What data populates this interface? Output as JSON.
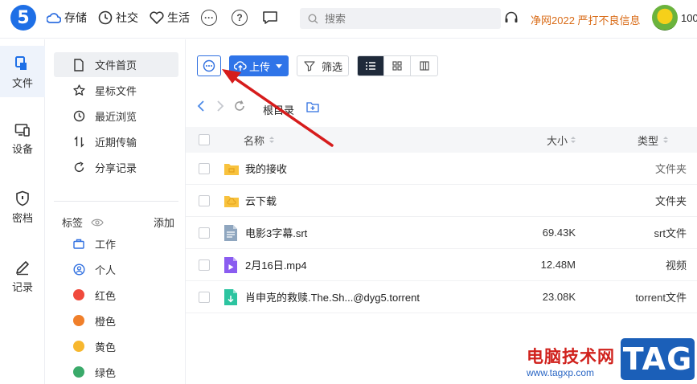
{
  "logo": "5",
  "nav": {
    "storage": "存储",
    "social": "社交",
    "life": "生活",
    "more": "···",
    "help": "?"
  },
  "search": {
    "placeholder": "搜索"
  },
  "promo": "净网2022 严打不良信息",
  "user": {
    "name": "100"
  },
  "rail": [
    {
      "label": "文件"
    },
    {
      "label": "设备"
    },
    {
      "label": "密档"
    },
    {
      "label": "记录"
    }
  ],
  "sidebar": {
    "items": [
      {
        "label": "文件首页"
      },
      {
        "label": "星标文件"
      },
      {
        "label": "最近浏览"
      },
      {
        "label": "近期传输"
      },
      {
        "label": "分享记录"
      }
    ],
    "tags_title": "标签",
    "tags_add": "添加",
    "tags": [
      {
        "label": "工作"
      },
      {
        "label": "个人"
      },
      {
        "label": "红色",
        "color": "#f04a3c"
      },
      {
        "label": "橙色",
        "color": "#f07f2a"
      },
      {
        "label": "黄色",
        "color": "#f7b72e"
      },
      {
        "label": "绿色",
        "color": "#3aaa6a"
      }
    ]
  },
  "toolbar": {
    "upload": "上传",
    "filter": "筛选"
  },
  "breadcrumb": {
    "title": "根目录"
  },
  "table": {
    "headers": {
      "name": "名称",
      "size": "大小",
      "type": "类型"
    },
    "rows": [
      {
        "name": "我的接收",
        "size": "",
        "type": "文件夹",
        "icon": "folder-receive-icon"
      },
      {
        "name": "云下载",
        "size": "",
        "type": "文件夹",
        "icon": "folder-download-icon"
      },
      {
        "name": "电影3字幕.srt",
        "size": "69.43K",
        "type": "srt文件",
        "icon": "srt-file-icon"
      },
      {
        "name": "2月16日.mp4",
        "size": "12.48M",
        "type": "视频",
        "icon": "video-file-icon"
      },
      {
        "name": "肖申克的救赎.The.Sh...@dyg5.torrent",
        "size": "23.08K",
        "type": "torrent文件",
        "icon": "torrent-file-icon"
      }
    ]
  },
  "watermark": {
    "text": "电脑技术网",
    "url": "www.tagxp.com",
    "logo": "TAG"
  },
  "colors": {
    "accent": "#2f74e8",
    "promo": "#d96b17",
    "arrow": "#d61c1c"
  }
}
